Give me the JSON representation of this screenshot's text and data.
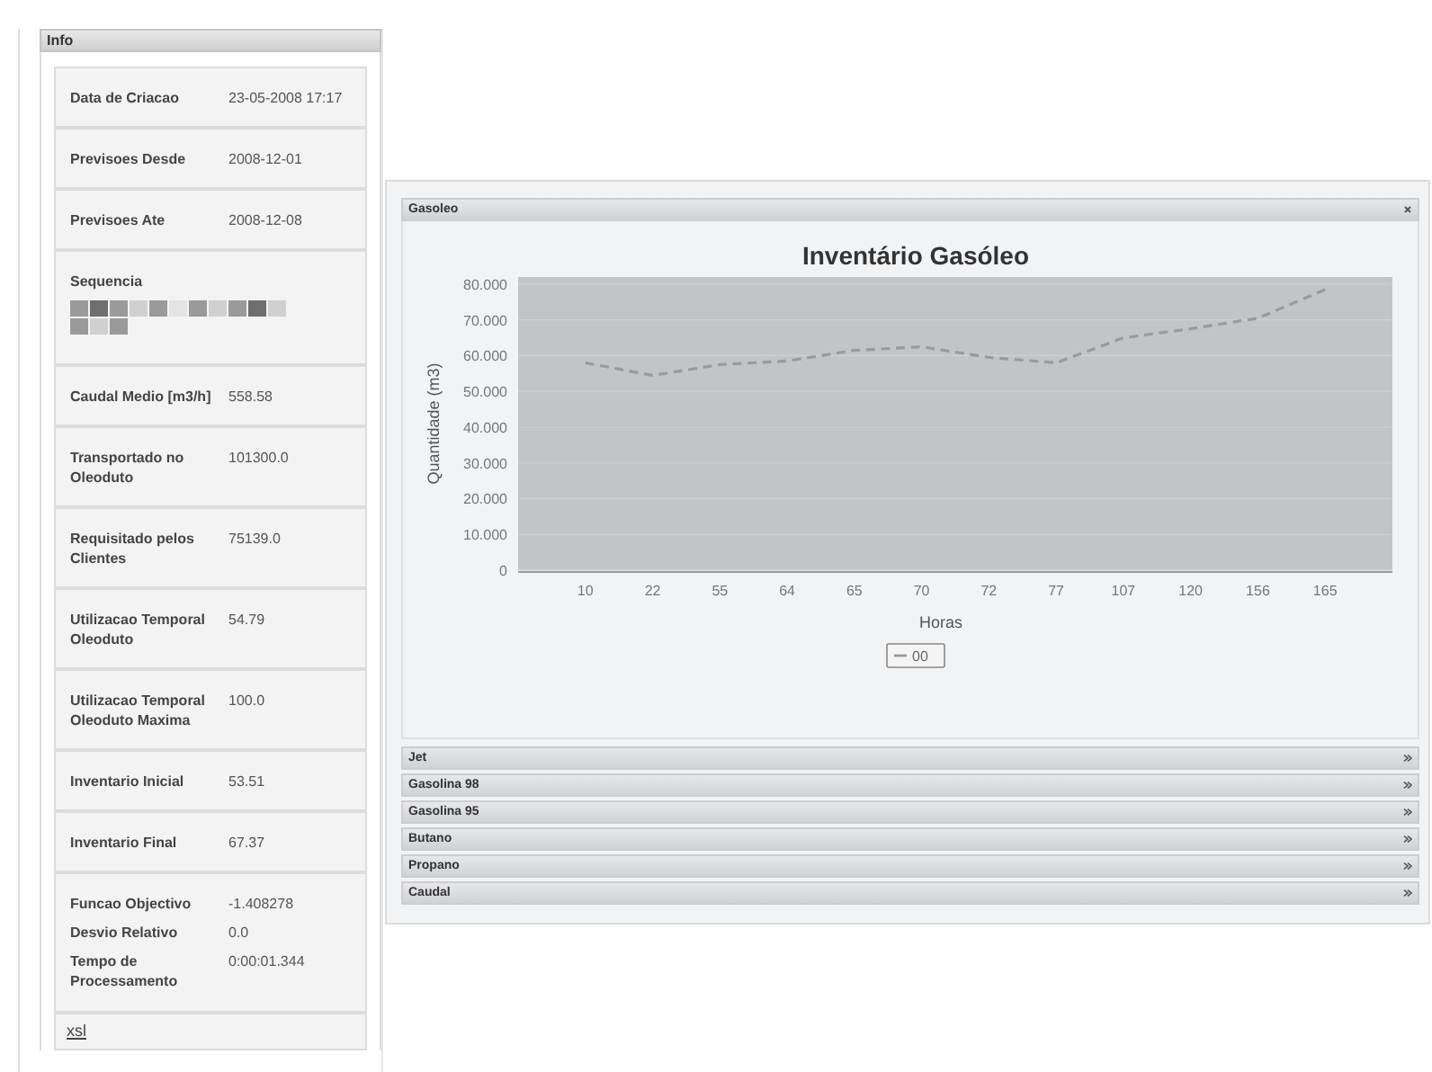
{
  "info_panel": {
    "title": "Info",
    "rows": [
      {
        "kind": "field",
        "label": "Data de Criacao",
        "value": "23-05-2008 17:17"
      },
      {
        "kind": "field",
        "label": "Previsoes Desde",
        "value": "2008-12-01"
      },
      {
        "kind": "field",
        "label": "Previsoes Ate",
        "value": "2008-12-08"
      },
      {
        "kind": "sequence",
        "label": "Sequencia",
        "chips": [
          {
            "color": "#9a9a9a"
          },
          {
            "color": "#6e6e6e"
          },
          {
            "color": "#9a9a9a"
          },
          {
            "color": "#d0d0d0"
          },
          {
            "color": "#9a9a9a"
          },
          {
            "color": "#e4e4e4"
          },
          {
            "color": "#9a9a9a"
          },
          {
            "color": "#d0d0d0"
          },
          {
            "color": "#9a9a9a"
          },
          {
            "color": "#6e6e6e"
          },
          {
            "color": "#d0d0d0"
          },
          {
            "color": "#9a9a9a"
          },
          {
            "color": "#d0d0d0"
          },
          {
            "color": "#9a9a9a"
          }
        ]
      },
      {
        "kind": "field",
        "label": "Caudal Medio [m3/h]",
        "value": "558.58"
      },
      {
        "kind": "field",
        "label": "Transportado no Oleoduto",
        "value": "101300.0"
      },
      {
        "kind": "field",
        "label": "Requisitado pelos Clientes",
        "value": "75139.0"
      },
      {
        "kind": "field",
        "label": "Utilizacao Temporal Oleoduto",
        "value": "54.79"
      },
      {
        "kind": "field",
        "label": "Utilizacao Temporal Oleoduto Maxima",
        "value": "100.0"
      },
      {
        "kind": "field",
        "label": "Inventario Inicial",
        "value": "53.51"
      },
      {
        "kind": "field",
        "label": "Inventario Final",
        "value": "67.37"
      },
      {
        "kind": "group",
        "pairs": [
          {
            "label": "Funcao Objectivo",
            "value": "-1.408278"
          },
          {
            "label": "Desvio Relativo",
            "value": "0.0"
          },
          {
            "label": "Tempo de Processamento",
            "value": "0:00:01.344"
          }
        ]
      },
      {
        "kind": "link",
        "text": "xsl"
      }
    ]
  },
  "sections": [
    {
      "title": "Gasoleo",
      "expanded": true,
      "chart_data": {
        "type": "line",
        "title": "Inventário Gasóleo",
        "xlabel": "Horas",
        "ylabel": "Quantidade (m3)",
        "categories": [
          "10",
          "22",
          "55",
          "64",
          "65",
          "70",
          "72",
          "77",
          "107",
          "120",
          "156",
          "165"
        ],
        "grid": true,
        "series": [
          {
            "name": "00",
            "color": "#9a9a9a",
            "line_style": "dashed",
            "values": [
              58,
              54.5,
              57.5,
              58.5,
              61.5,
              62.5,
              59.5,
              58,
              65,
              67.5,
              70.5,
              78.5
            ]
          }
        ],
        "ylim": [
          0,
          82
        ],
        "yticks": [
          {
            "value": 0,
            "label": "0"
          },
          {
            "value": 10,
            "label": "10.000"
          },
          {
            "value": 20,
            "label": "20.000"
          },
          {
            "value": 30,
            "label": "30.000"
          },
          {
            "value": 40,
            "label": "40.000"
          },
          {
            "value": 50,
            "label": "50.000"
          },
          {
            "value": 60,
            "label": "60.000"
          },
          {
            "value": 70,
            "label": "70.000"
          },
          {
            "value": 80,
            "label": "80.000"
          }
        ]
      }
    },
    {
      "title": "Jet",
      "expanded": false
    },
    {
      "title": "Gasolina 98",
      "expanded": false
    },
    {
      "title": "Gasolina 95",
      "expanded": false
    },
    {
      "title": "Butano",
      "expanded": false
    },
    {
      "title": "Propano",
      "expanded": false
    },
    {
      "title": "Caudal",
      "expanded": false
    }
  ]
}
